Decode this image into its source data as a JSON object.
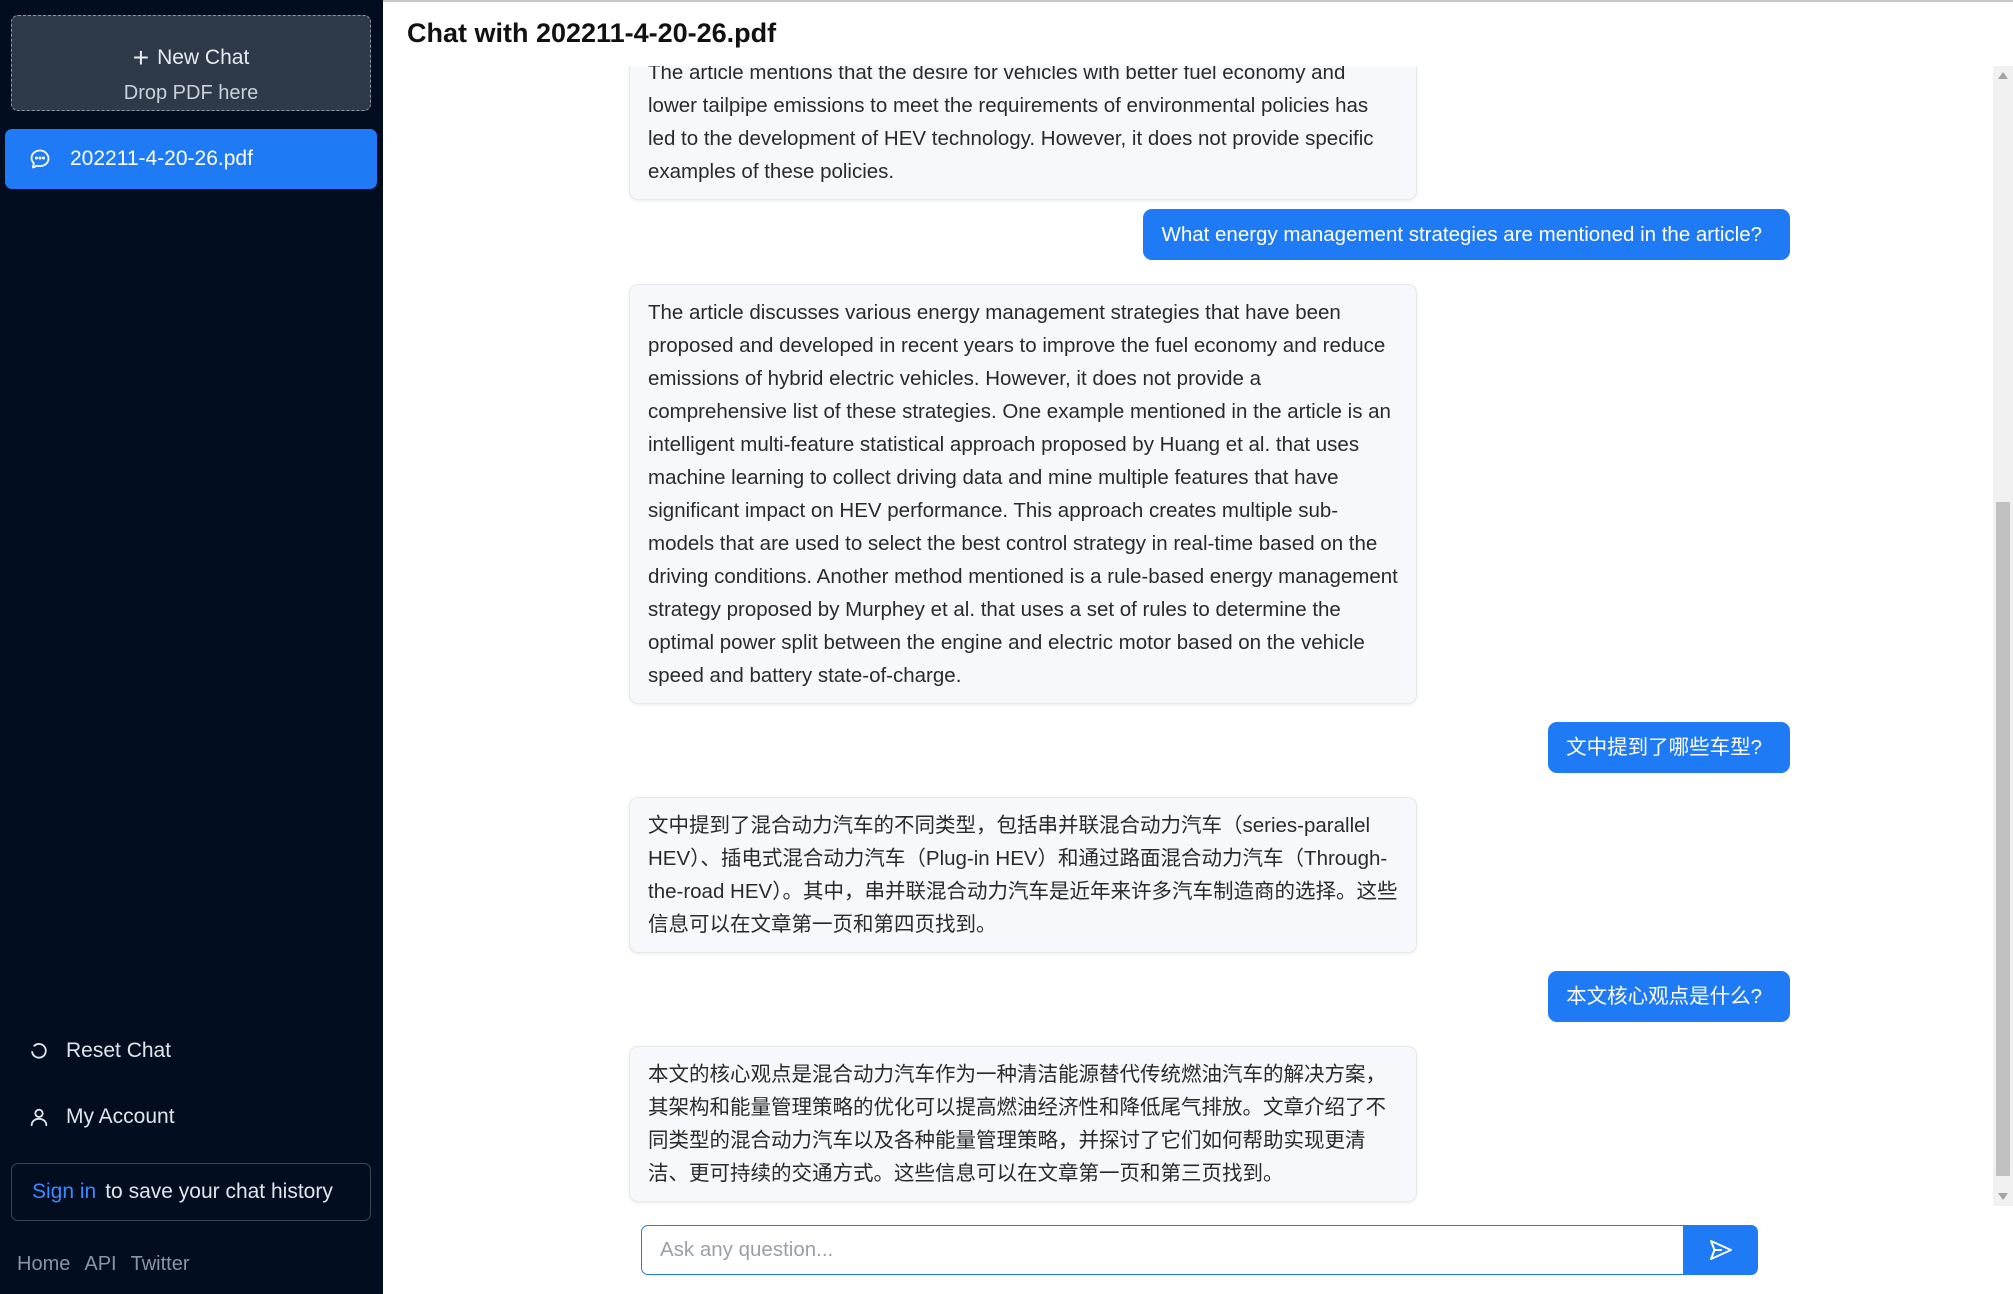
{
  "sidebar": {
    "new_chat_label": "New Chat",
    "drop_hint": "Drop PDF here",
    "chats": [
      {
        "label": "202211-4-20-26.pdf"
      }
    ],
    "reset_label": "Reset Chat",
    "account_label": "My Account",
    "signin_link": "Sign in",
    "signin_text": "to save your chat history",
    "footer": {
      "home": "Home",
      "api": "API",
      "twitter": "Twitter"
    }
  },
  "header": {
    "title": "Chat with 202211-4-20-26.pdf"
  },
  "messages": [
    {
      "role": "bot",
      "text": "The article mentions that the desire for vehicles with better fuel economy and lower tailpipe emissions to meet the requirements of environmental policies has led to the development of HEV technology. However, it does not provide specific examples of these policies."
    },
    {
      "role": "user",
      "text": "What energy management strategies are mentioned in the article?"
    },
    {
      "role": "bot",
      "text": "The article discusses various energy management strategies that have been proposed and developed in recent years to improve the fuel economy and reduce emissions of hybrid electric vehicles. However, it does not provide a comprehensive list of these strategies. One example mentioned in the article is an intelligent multi-feature statistical approach proposed by Huang et al. that uses machine learning to collect driving data and mine multiple features that have significant impact on HEV performance. This approach creates multiple sub-models that are used to select the best control strategy in real-time based on the driving conditions. Another method mentioned is a rule-based energy management strategy proposed by Murphey et al. that uses a set of rules to determine the optimal power split between the engine and electric motor based on the vehicle speed and battery state-of-charge."
    },
    {
      "role": "user",
      "text": "文中提到了哪些车型?"
    },
    {
      "role": "bot",
      "text": "文中提到了混合动力汽车的不同类型，包括串并联混合动力汽车（series-parallel HEV）、插电式混合动力汽车（Plug-in HEV）和通过路面混合动力汽车（Through-the-road HEV）。其中，串并联混合动力汽车是近年来许多汽车制造商的选择。这些信息可以在文章第一页和第四页找到。"
    },
    {
      "role": "user",
      "text": "本文核心观点是什么?"
    },
    {
      "role": "bot",
      "text": "本文的核心观点是混合动力汽车作为一种清洁能源替代传统燃油汽车的解决方案，其架构和能量管理策略的优化可以提高燃油经济性和降低尾气排放。文章介绍了不同类型的混合动力汽车以及各种能量管理策略，并探讨了它们如何帮助实现更清洁、更可持续的交通方式。这些信息可以在文章第一页和第三页找到。"
    }
  ],
  "input": {
    "placeholder": "Ask any question...",
    "value": ""
  },
  "icons": {
    "new_chat": "plus-icon",
    "chat_item": "chat-bubble-icon",
    "reset": "refresh-icon",
    "account": "user-icon",
    "send": "send-icon"
  },
  "colors": {
    "accent": "#1f7af5",
    "sidebar_bg": "#020d20",
    "bot_bubble": "#f7f8fc"
  }
}
